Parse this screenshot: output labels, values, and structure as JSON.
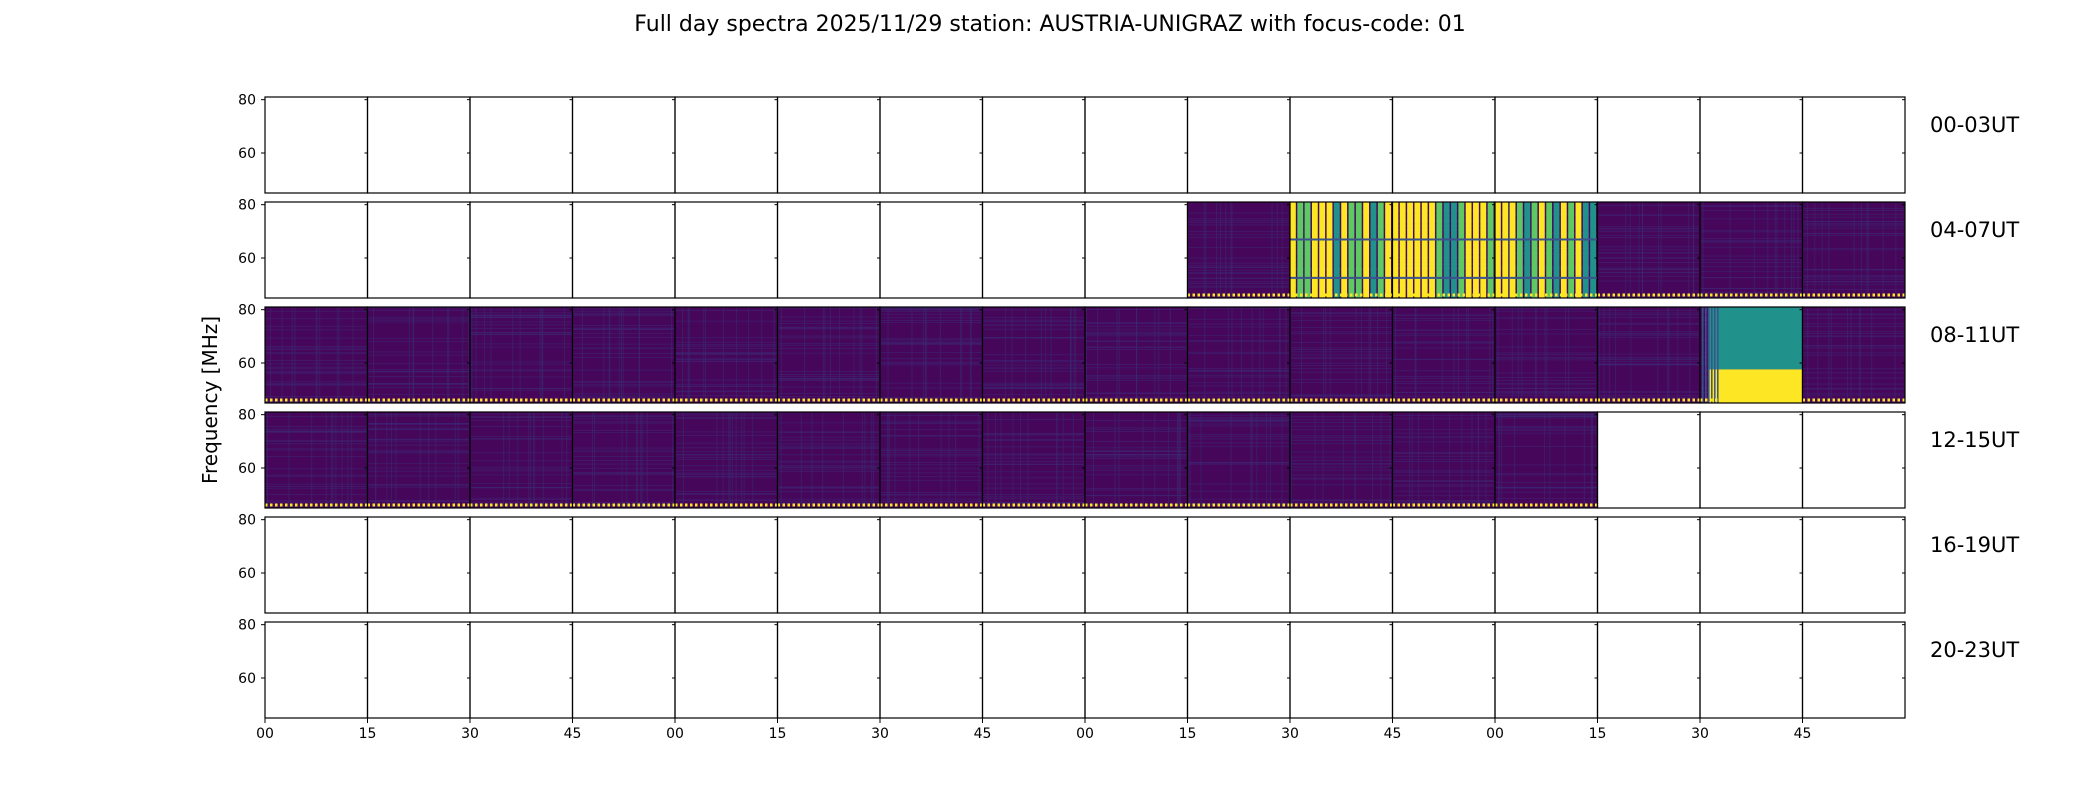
{
  "title": "Full day spectra 2025/11/29 station: AUSTRIA-UNIGRAZ with focus-code: 01",
  "chart_data": {
    "type": "heatmap",
    "title": "Full day spectra 2025/11/29 station: AUSTRIA-UNIGRAZ with focus-code: 01",
    "ylabel": "Frequency [MHz]",
    "xlabel": "",
    "ylim": [
      45,
      81
    ],
    "y_ticks": [
      "80",
      "60"
    ],
    "x_ticks": [
      "00",
      "15",
      "30",
      "45",
      "00",
      "15",
      "30",
      "45",
      "00",
      "15",
      "30",
      "45",
      "00",
      "15",
      "30",
      "45"
    ],
    "panels_per_row": 16,
    "colormap": [
      "#440154",
      "#3b528b",
      "#21918c",
      "#5ec962",
      "#fde725"
    ],
    "rows": [
      {
        "label": "00-03UT",
        "panels": [
          "empty",
          "empty",
          "empty",
          "empty",
          "empty",
          "empty",
          "empty",
          "empty",
          "empty",
          "empty",
          "empty",
          "empty",
          "empty",
          "empty",
          "empty",
          "empty"
        ]
      },
      {
        "label": "04-07UT",
        "panels": [
          "empty",
          "empty",
          "empty",
          "empty",
          "empty",
          "empty",
          "empty",
          "empty",
          "empty",
          "low",
          "high",
          "high",
          "high",
          "low",
          "low",
          "low"
        ]
      },
      {
        "label": "08-11UT",
        "panels": [
          "low",
          "low",
          "low",
          "low",
          "low",
          "low",
          "low",
          "low",
          "low",
          "low",
          "low",
          "low",
          "low",
          "low",
          "mid",
          "low"
        ]
      },
      {
        "label": "12-15UT",
        "panels": [
          "low",
          "low",
          "low",
          "low",
          "low",
          "low",
          "low",
          "low",
          "low",
          "low",
          "low",
          "low",
          "low",
          "empty",
          "empty",
          "empty"
        ]
      },
      {
        "label": "16-19UT",
        "panels": [
          "empty",
          "empty",
          "empty",
          "empty",
          "empty",
          "empty",
          "empty",
          "empty",
          "empty",
          "empty",
          "empty",
          "empty",
          "empty",
          "empty",
          "empty",
          "empty"
        ]
      },
      {
        "label": "20-23UT",
        "panels": [
          "empty",
          "empty",
          "empty",
          "empty",
          "empty",
          "empty",
          "empty",
          "empty",
          "empty",
          "empty",
          "empty",
          "empty",
          "empty",
          "empty",
          "empty",
          "empty"
        ]
      }
    ]
  }
}
